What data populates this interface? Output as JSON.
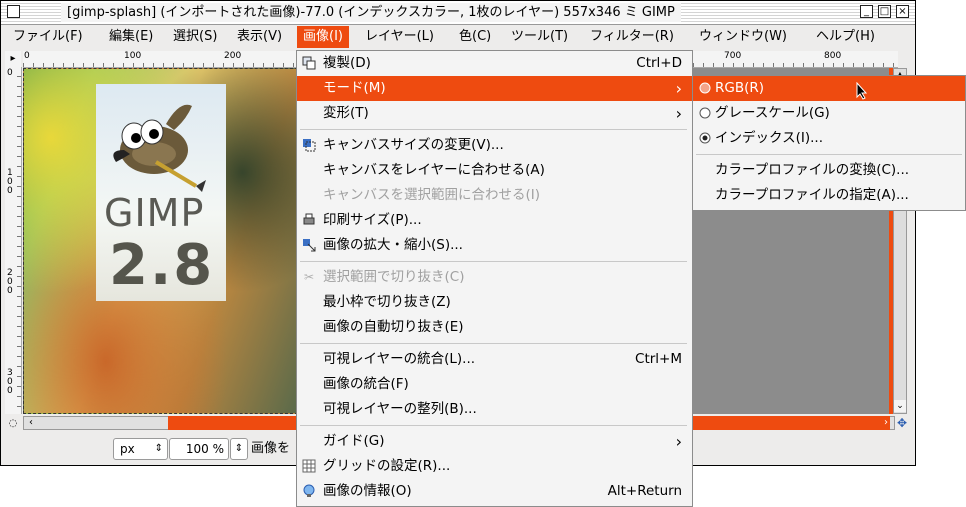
{
  "window": {
    "title": "[gimp-splash] (インポートされた画像)-77.0 (インデックスカラー, 1枚のレイヤー) 557x346 ミ GIMP",
    "minimize_glyph": "_",
    "maximize_glyph": "□",
    "close_glyph": "×"
  },
  "menubar": [
    "ファイル(F)",
    "編集(E)",
    "選択(S)",
    "表示(V)",
    "画像(I)",
    "レイヤー(L)",
    "色(C)",
    "ツール(T)",
    "フィルター(R)",
    "ウィンドウ(W)",
    "ヘルプ(H)"
  ],
  "rulers": {
    "top": [
      "0",
      "100",
      "200",
      "700",
      "800"
    ],
    "left": [
      "0",
      "1 0 0",
      "2 0 0",
      "3 0 0"
    ]
  },
  "splash": {
    "word": "GIMP",
    "version": "2.8"
  },
  "statusbar": {
    "unit": "px",
    "zoom": "100 %",
    "message": "画像を"
  },
  "image_menu": {
    "items": [
      {
        "label": "複製(D)",
        "accel": "Ctrl+D",
        "icon": "duplicate-icon",
        "state": "normal"
      },
      {
        "label": "モード(M)",
        "accel": "",
        "icon": "",
        "state": "highlighted",
        "submenu": true
      },
      {
        "label": "変形(T)",
        "accel": "",
        "icon": "",
        "state": "normal",
        "submenu": true
      },
      {
        "label": "キャンバスサイズの変更(V)...",
        "accel": "",
        "icon": "canvas-size-icon",
        "state": "normal"
      },
      {
        "label": "キャンバスをレイヤーに合わせる(A)",
        "accel": "",
        "icon": "",
        "state": "normal"
      },
      {
        "label": "キャンバスを選択範囲に合わせる(I)",
        "accel": "",
        "icon": "",
        "state": "disabled"
      },
      {
        "label": "印刷サイズ(P)...",
        "accel": "",
        "icon": "print-size-icon",
        "state": "normal"
      },
      {
        "label": "画像の拡大・縮小(S)...",
        "accel": "",
        "icon": "scale-icon",
        "state": "normal"
      },
      {
        "label": "選択範囲で切り抜き(C)",
        "accel": "",
        "icon": "crop-icon",
        "state": "disabled"
      },
      {
        "label": "最小枠で切り抜き(Z)",
        "accel": "",
        "icon": "",
        "state": "normal"
      },
      {
        "label": "画像の自動切り抜き(E)",
        "accel": "",
        "icon": "",
        "state": "normal"
      },
      {
        "label": "可視レイヤーの統合(L)...",
        "accel": "Ctrl+M",
        "icon": "",
        "state": "normal"
      },
      {
        "label": "画像の統合(F)",
        "accel": "",
        "icon": "",
        "state": "normal"
      },
      {
        "label": "可視レイヤーの整列(B)...",
        "accel": "",
        "icon": "",
        "state": "normal"
      },
      {
        "label": "ガイド(G)",
        "accel": "",
        "icon": "",
        "state": "normal",
        "submenu": true
      },
      {
        "label": "グリッドの設定(R)...",
        "accel": "",
        "icon": "grid-icon",
        "state": "normal"
      },
      {
        "label": "画像の情報(O)",
        "accel": "Alt+Return",
        "icon": "info-icon",
        "state": "normal"
      }
    ]
  },
  "mode_submenu": {
    "items": [
      {
        "label": "RGB(R)",
        "kind": "radio",
        "checked": false,
        "state": "highlighted"
      },
      {
        "label": "グレースケール(G)",
        "kind": "radio",
        "checked": false,
        "state": "normal"
      },
      {
        "label": "インデックス(I)...",
        "kind": "radio",
        "checked": true,
        "state": "normal"
      },
      {
        "label": "カラープロファイルの変換(C)...",
        "kind": "plain",
        "checked": false,
        "state": "normal"
      },
      {
        "label": "カラープロファイルの指定(A)...",
        "kind": "plain",
        "checked": false,
        "state": "normal"
      }
    ]
  },
  "colors": {
    "accent": "#ee4b10",
    "menu_bg": "#f4f4f4",
    "canvas_bg": "#8c8c8c",
    "disabled_text": "#a0a0a0"
  }
}
